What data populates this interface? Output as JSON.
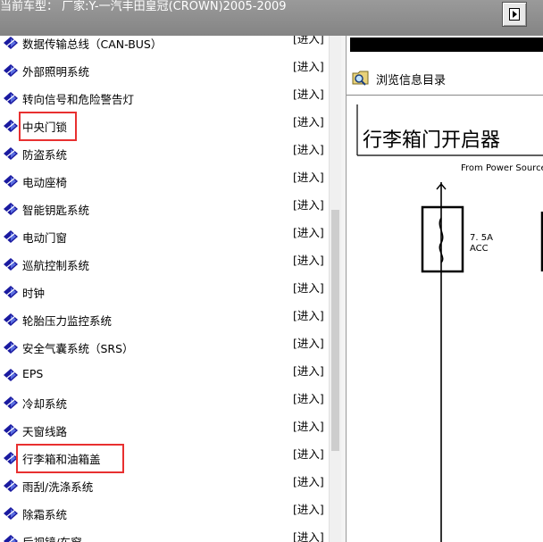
{
  "header": {
    "title": "当前车型：  厂家:Y-一汽丰田皇冠(CROWN)2005-2009"
  },
  "list": {
    "enter_label": "[进入]",
    "items": [
      {
        "label": "数据传输总线（CAN-BUS）"
      },
      {
        "label": "外部照明系统"
      },
      {
        "label": "转向信号和危险警告灯"
      },
      {
        "label": "中央门锁"
      },
      {
        "label": "防盗系统"
      },
      {
        "label": "电动座椅"
      },
      {
        "label": "智能钥匙系统"
      },
      {
        "label": "电动门窗"
      },
      {
        "label": "巡航控制系统"
      },
      {
        "label": "时钟"
      },
      {
        "label": "轮胎压力监控系统"
      },
      {
        "label": "安全气囊系统（SRS）"
      },
      {
        "label": "EPS"
      },
      {
        "label": "冷却系统"
      },
      {
        "label": "天窗线路"
      },
      {
        "label": "行李箱和油箱盖"
      },
      {
        "label": "雨刮/洗涤系统"
      },
      {
        "label": "除霜系统"
      },
      {
        "label": "后视镜/车窗"
      }
    ]
  },
  "viewer": {
    "toc_label": "浏览信息目录",
    "diagram_title": "行李箱门开启器",
    "source_label": "From Power Source",
    "fuse_rating": "7. 5A",
    "fuse_name": "ACC"
  },
  "colors": {
    "header_bg": "#8f8f8f",
    "highlight": "#e83030",
    "item_icon": "#1a1aa0"
  }
}
